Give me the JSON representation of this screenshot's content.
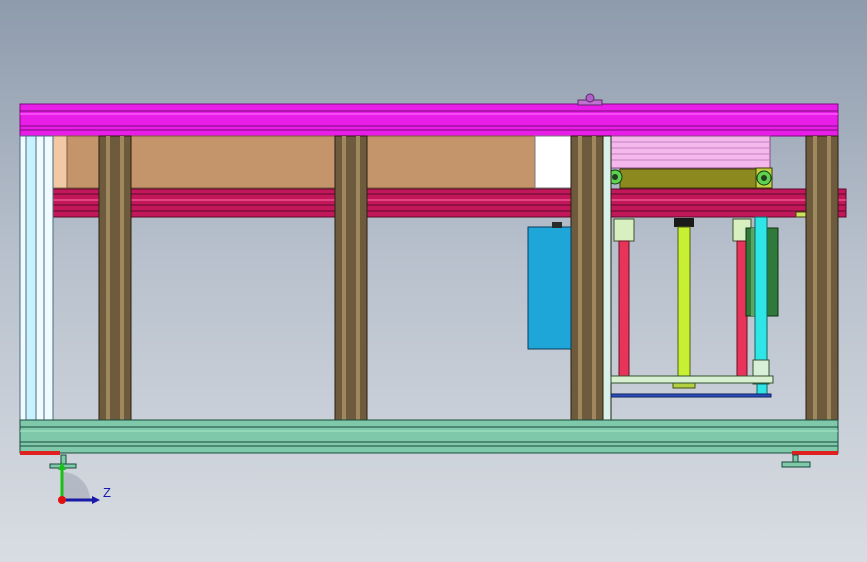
{
  "viewport": {
    "background_top": "#8e9bac",
    "background_bottom": "#d9dde3"
  },
  "model": {
    "colors": {
      "top_beam": "#e81ee8",
      "upper_rail": "#c2185b",
      "panel_fill": "#c4956a",
      "post": "#6e5a3c",
      "base": "#7fc8a9",
      "motor_box": "#1ea6d9",
      "rod_red": "#e8345a",
      "rod_yellow": "#c8f032",
      "rod_cyan": "#2ee6e6",
      "carriage": "#8c8a1e",
      "cover_pink": "#f5b8ec"
    }
  },
  "triad": {
    "axis_z_label": "Z",
    "axis_colors": {
      "x": "#e01010",
      "y": "#18c018",
      "z": "#1a1aa8"
    }
  }
}
